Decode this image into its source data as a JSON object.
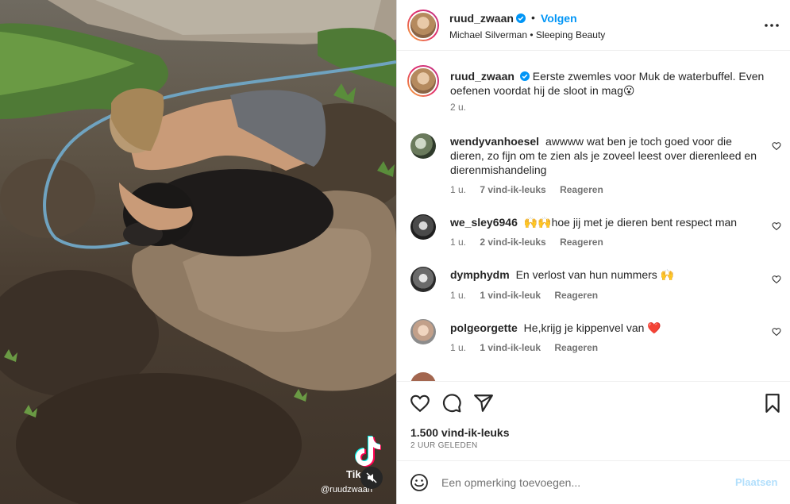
{
  "post": {
    "author": "ruud_zwaan",
    "follow_label": "Volgen",
    "separator": "•",
    "music": "Michael Silverman • Sleeping Beauty",
    "caption": "Eerste zwemles voor Muk de waterbuffel. Even oefenen voordat hij de sloot in mag😮",
    "caption_age": "2 u."
  },
  "comments": [
    {
      "user": "wendyvanhoesel",
      "text": "awwww wat ben je toch goed voor die dieren, zo fijn om te zien als je zoveel leest over dierenleed en dierenmishandeling",
      "age": "1 u.",
      "likes": "7 vind-ik-leuks",
      "reply": "Reageren"
    },
    {
      "user": "we_sley6946",
      "text": "🙌🙌hoe jij met je dieren bent respect man",
      "age": "1 u.",
      "likes": "2 vind-ik-leuks",
      "reply": "Reageren"
    },
    {
      "user": "dymphydm",
      "text": "En verlost van hun nummers 🙌",
      "age": "1 u.",
      "likes": "1 vind-ik-leuk",
      "reply": "Reageren"
    },
    {
      "user": "polgeorgette",
      "text": "He,krijg je kippenvel van ❤️",
      "age": "1 u.",
      "likes": "1 vind-ik-leuk",
      "reply": "Reageren"
    }
  ],
  "stats": {
    "likes": "1.500 vind-ik-leuks",
    "time": "2 UUR GELEDEN"
  },
  "composer": {
    "placeholder": "Een opmerking toevoegen...",
    "post_label": "Plaatsen"
  },
  "overlay": {
    "tiktok_label": "Tik",
    "tiktok_user": "@ruudzwaan"
  },
  "icons": {
    "verified": "verified-badge-icon",
    "more": "more-options-icon",
    "like": "heart-icon",
    "comment": "comment-icon",
    "share": "share-icon",
    "save": "bookmark-icon",
    "emoji": "emoji-icon",
    "mute": "muted-icon"
  },
  "colors": {
    "accent": "#0095f6",
    "post_disabled": "#b2dffc",
    "secondary_text": "#737373"
  }
}
